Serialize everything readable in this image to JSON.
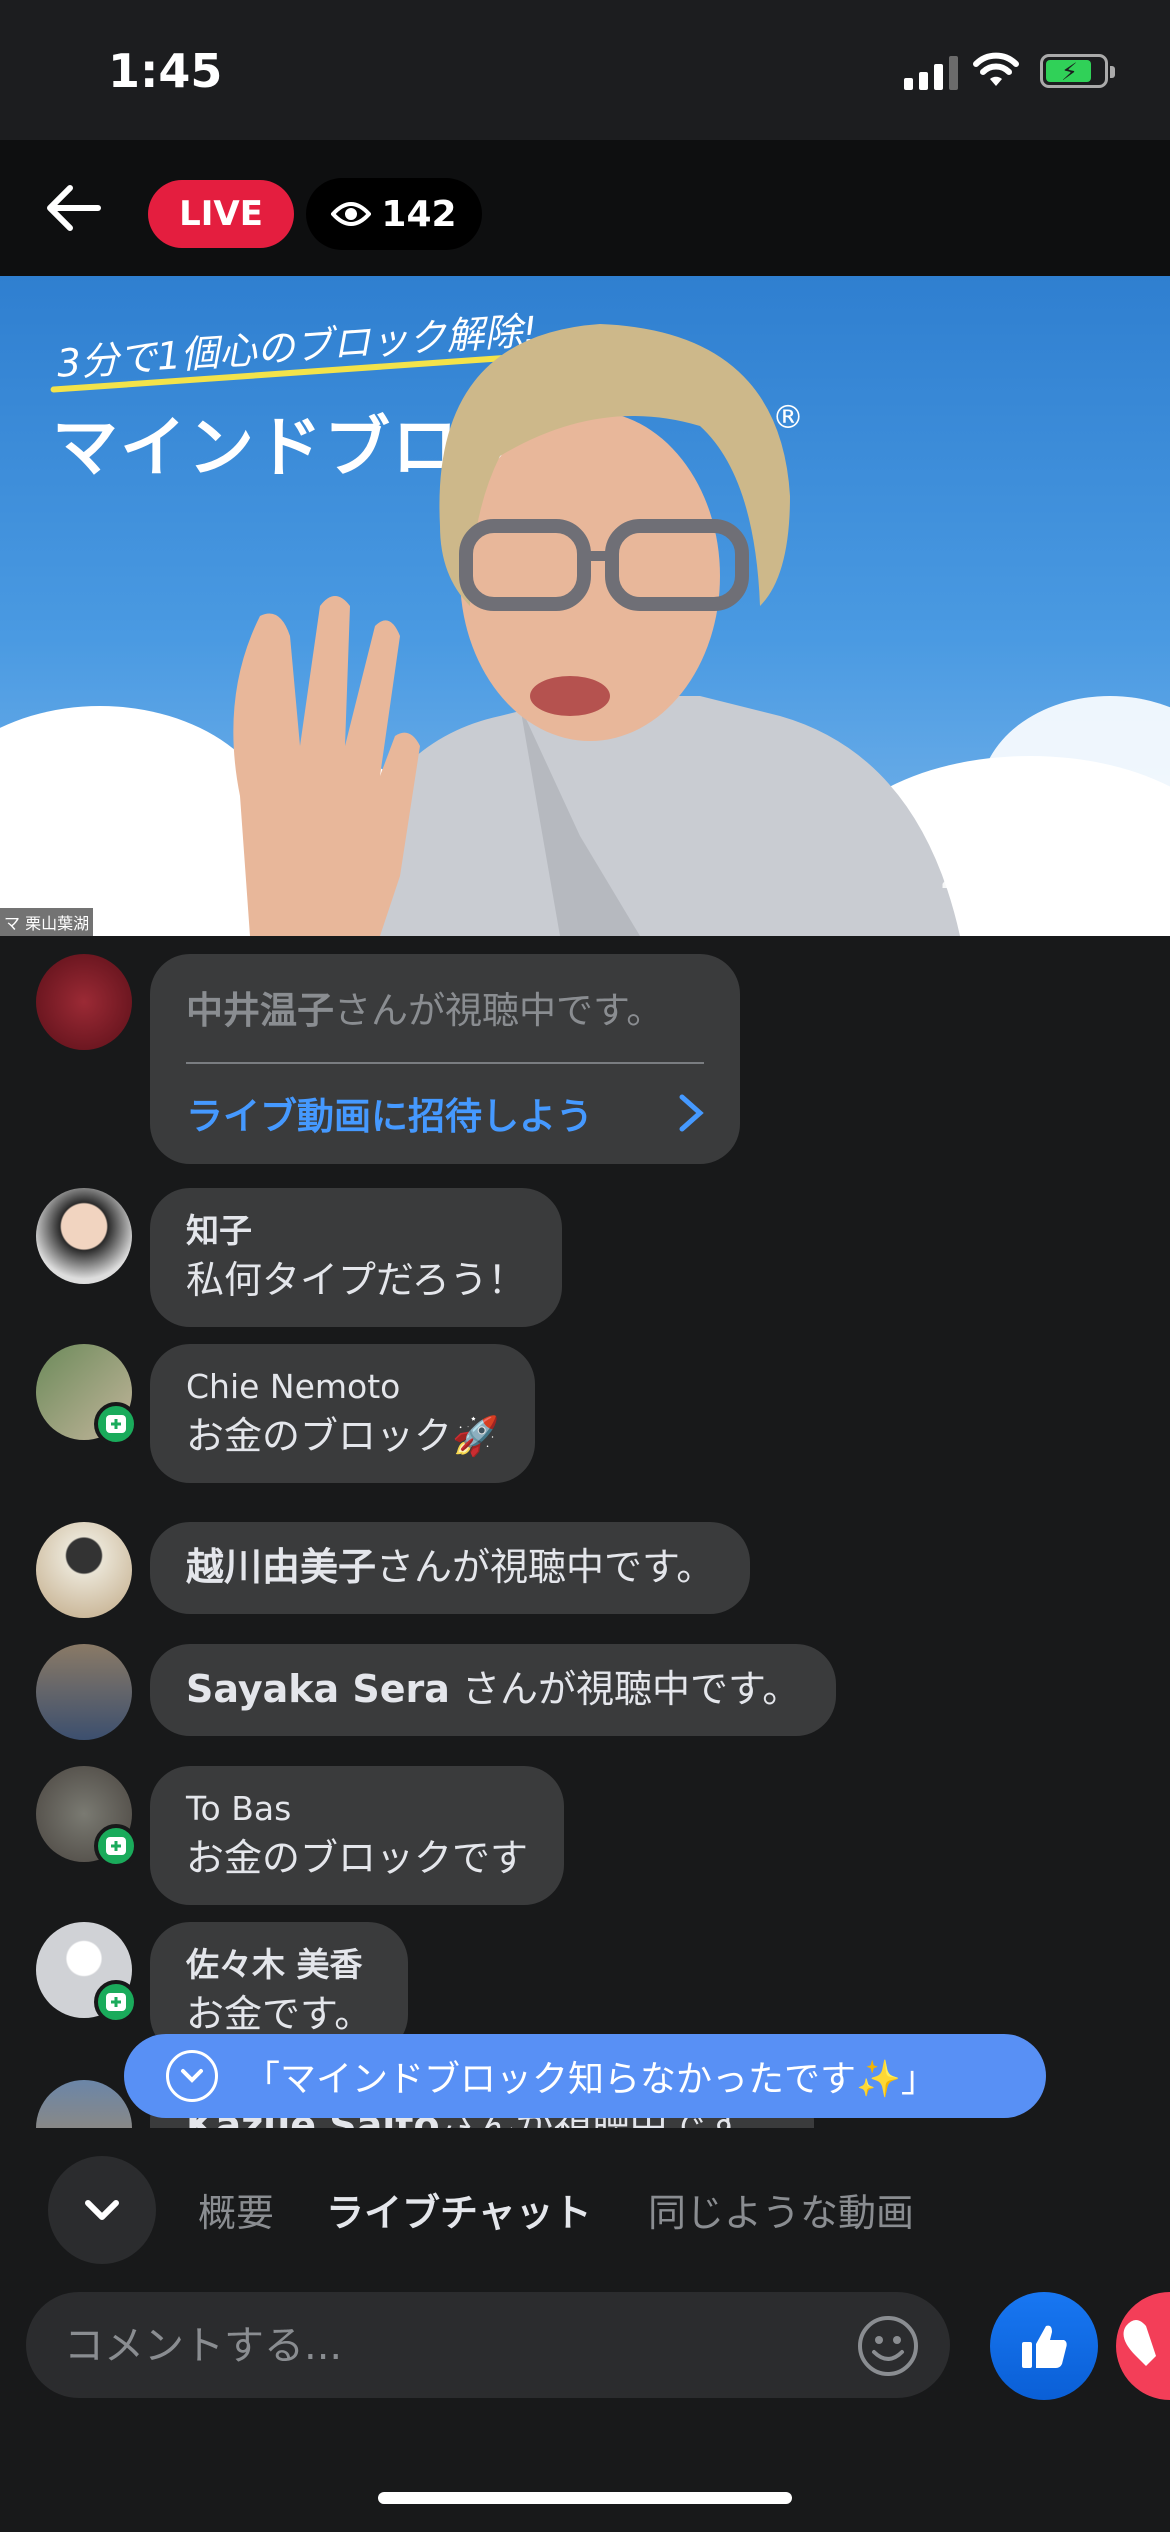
{
  "status_bar": {
    "time": "1:45"
  },
  "live": {
    "badge": "LIVE",
    "viewer_count": "142"
  },
  "video": {
    "slide_subtitle": "3分で1個心のブロック解除!",
    "slide_title": "マインドブロック",
    "registered_mark": "®",
    "watermark": "zoom",
    "speaker_caption": "マ 栗山葉湖"
  },
  "chat": {
    "invite": {
      "name": "中井温子",
      "suffix": "さんが視聴中です。",
      "cta": "ライブ動画に招待しよう"
    },
    "messages": [
      {
        "name": "知子",
        "text": "私何タイプだろう！"
      },
      {
        "name": "Chie Nemoto",
        "text": "お金のブロック🚀"
      },
      {
        "name": "越川由美子",
        "text": "さんが視聴中です。"
      },
      {
        "name": "Sayaka Sera",
        "text": "さんが視聴中です。"
      },
      {
        "name": "To Bas",
        "text": "お金のブロックです"
      },
      {
        "name": "佐々木 美香",
        "text": "お金です。"
      },
      {
        "name": "Kazue Saito",
        "text": "さんが視聴中です。"
      }
    ],
    "pinned": "「マインドブロック知らなかったです✨」"
  },
  "tabs": {
    "overview": "概要",
    "live_chat": "ライブチャット",
    "similar": "同じような動画"
  },
  "composer": {
    "placeholder": "コメントする..."
  },
  "colors": {
    "live": "#e41e3f",
    "accent": "#4599ff",
    "pinned": "#5890f5",
    "like": "#1877f2",
    "love": "#f33e58"
  }
}
